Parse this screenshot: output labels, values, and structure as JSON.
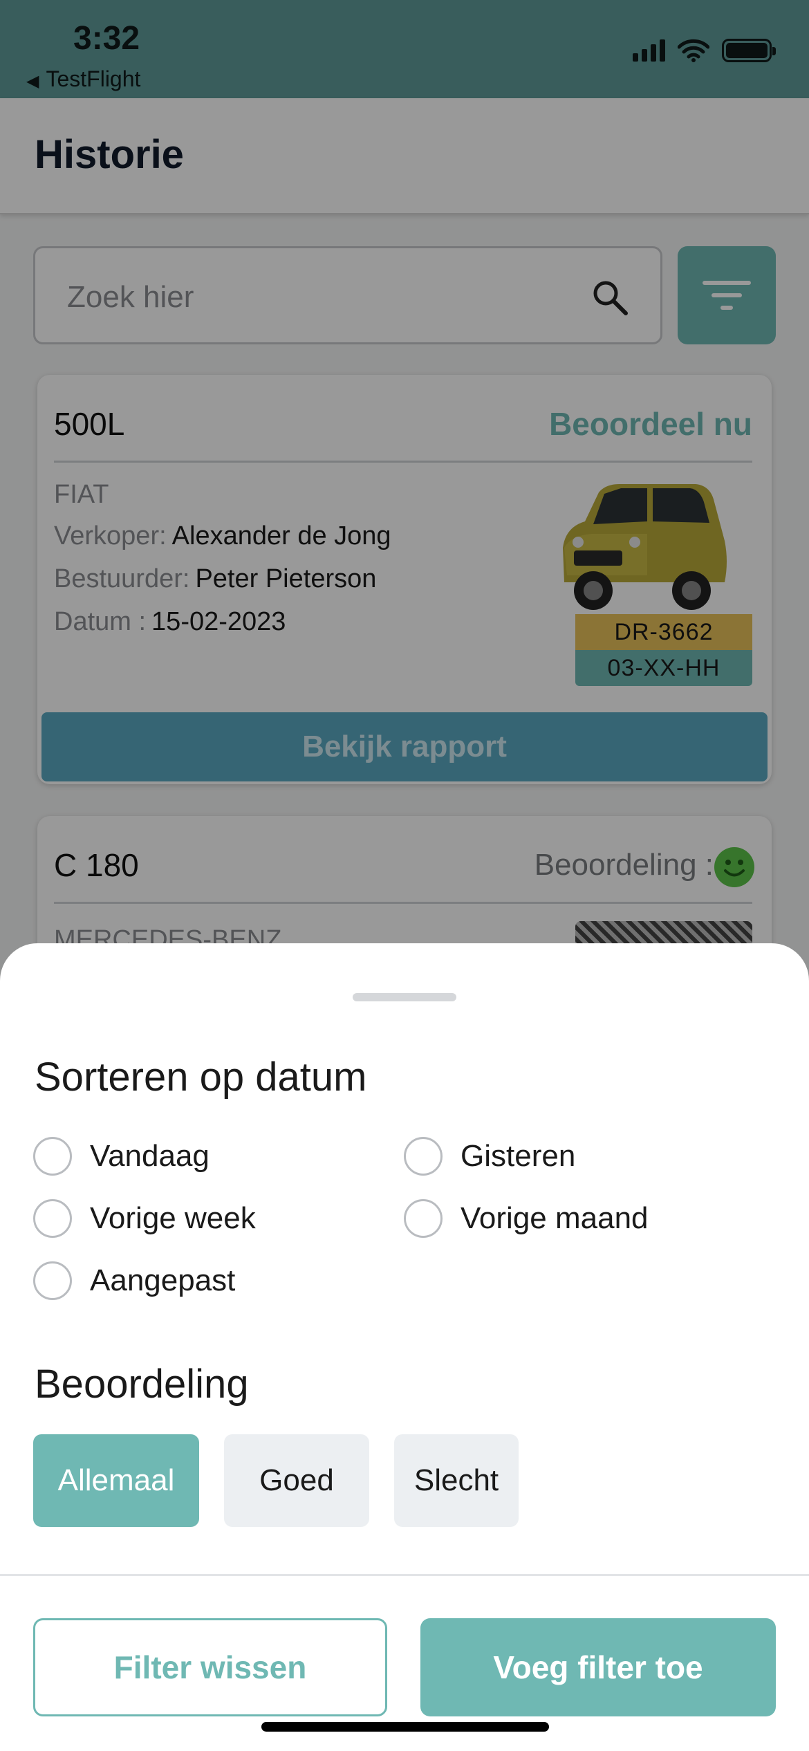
{
  "status_bar": {
    "time": "3:32",
    "back_app": "TestFlight"
  },
  "header": {
    "title": "Historie"
  },
  "search": {
    "placeholder": "Zoek hier",
    "value": ""
  },
  "cards": [
    {
      "model": "500L",
      "action_label": "Beoordeel nu",
      "brand": "FIAT",
      "seller_label": "Verkoper:",
      "seller": "Alexander de Jong",
      "driver_label": "Bestuurder:",
      "driver": "Peter Pieterson",
      "date_label": "Datum :",
      "date": "15-02-2023",
      "plate_primary": "DR-3662",
      "plate_secondary": "03-XX-HH",
      "report_button": "Bekijk rapport"
    },
    {
      "model": "C 180",
      "rating_label": "Beoordeling :",
      "rating_icon": "smiley-happy-icon",
      "brand": "MERCEDES-BENZ"
    }
  ],
  "sheet": {
    "date_section_title": "Sorteren op datum",
    "date_options": [
      "Vandaag",
      "Gisteren",
      "Vorige week",
      "Vorige maand",
      "Aangepast"
    ],
    "rating_section_title": "Beoordeling",
    "rating_options": [
      "Allemaal",
      "Goed",
      "Slecht"
    ],
    "rating_selected": "Allemaal",
    "clear_button": "Filter wissen",
    "apply_button": "Voeg filter toe"
  },
  "colors": {
    "accent": "#6fb8b3",
    "report_button": "#5aa9c2",
    "plate_yellow": "#e8c25a",
    "smiley": "#5cc44a"
  }
}
